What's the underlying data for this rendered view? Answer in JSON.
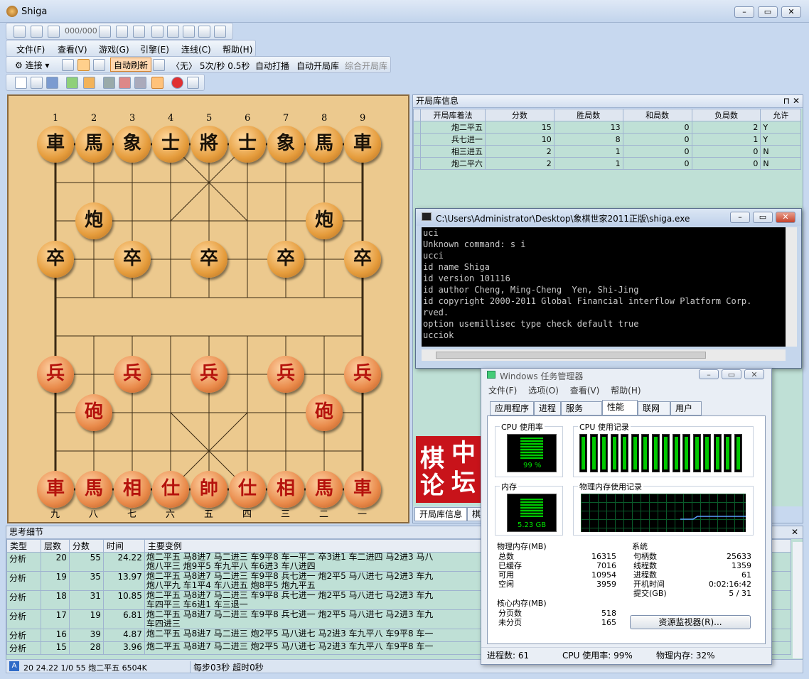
{
  "app": {
    "title": "Shiga",
    "move_counter": "000/000"
  },
  "menu": [
    "文件(F)",
    "查看(V)",
    "游戏(G)",
    "引擎(E)",
    "连线(C)",
    "帮助(H)"
  ],
  "toolbar2": {
    "connect": "连接",
    "auto_refresh": "自动刷新",
    "info": "〈无〉 5次/秒 0.5秒",
    "auto_play": "自动打播",
    "auto_book": "自动开局库",
    "combined_book": "综合开局库"
  },
  "board": {
    "top_coords": [
      "1",
      "2",
      "3",
      "4",
      "5",
      "6",
      "7",
      "8",
      "9"
    ],
    "bottom_coords": [
      "九",
      "八",
      "七",
      "六",
      "五",
      "四",
      "三",
      "二",
      "一"
    ],
    "black_back": [
      "車",
      "馬",
      "象",
      "士",
      "將",
      "士",
      "象",
      "馬",
      "車"
    ],
    "black_cannon": "炮",
    "black_pawn": "卒",
    "red_back": [
      "車",
      "馬",
      "相",
      "仕",
      "帥",
      "仕",
      "相",
      "馬",
      "車"
    ],
    "red_cannon": "砲",
    "red_pawn": "兵"
  },
  "book": {
    "title": "开局库信息",
    "headers": [
      "开局库着法",
      "分数",
      "胜局数",
      "和局数",
      "负局数",
      "允许"
    ],
    "rows": [
      [
        "炮二平五",
        "15",
        "13",
        "0",
        "2",
        "Y"
      ],
      [
        "兵七进一",
        "10",
        "8",
        "0",
        "1",
        "Y"
      ],
      [
        "相三进五",
        "2",
        "1",
        "0",
        "0",
        "N"
      ],
      [
        "炮二平六",
        "2",
        "1",
        "0",
        "0",
        "N"
      ]
    ],
    "tab1": "开局库信息",
    "tab2": "棋谱"
  },
  "console": {
    "title": "C:\\Users\\Administrator\\Desktop\\象棋世家2011正版\\shiga.exe",
    "lines": [
      "uci",
      "Unknown command: s i",
      "ucci",
      "id name Shiga",
      "id version 101116",
      "id author Cheng, Ming-Cheng  Yen, Shi-Jing",
      "id copyright 2000-2011 Global Financial interflow Platform Corp.",
      "rved.",
      "option usemillisec type check default true",
      "ucciok"
    ]
  },
  "logo": [
    "棋",
    "中",
    "论",
    "坛"
  ],
  "taskmgr": {
    "title": "Windows 任务管理器",
    "menu": [
      "文件(F)",
      "选项(O)",
      "查看(V)",
      "帮助(H)"
    ],
    "tabs": [
      "应用程序",
      "进程",
      "服务",
      "性能",
      "联网",
      "用户"
    ],
    "cpu_usage_label": "CPU 使用率",
    "cpu_value": "99 %",
    "cpu_history_label": "CPU 使用记录",
    "mem_label": "内存",
    "mem_value": "5.23 GB",
    "mem_history_label": "物理内存使用记录",
    "phys_title": "物理内存(MB)",
    "phys": [
      [
        "总数",
        "16315"
      ],
      [
        "已缓存",
        "7016"
      ],
      [
        "可用",
        "10954"
      ],
      [
        "空闲",
        "3959"
      ]
    ],
    "sys_title": "系统",
    "sys": [
      [
        "句柄数",
        "25633"
      ],
      [
        "线程数",
        "1359"
      ],
      [
        "进程数",
        "61"
      ],
      [
        "开机时间",
        "0:02:16:42"
      ],
      [
        "提交(GB)",
        "5 / 31"
      ]
    ],
    "kernel_title": "核心内存(MB)",
    "kernel": [
      [
        "分页数",
        "518"
      ],
      [
        "未分页",
        "165"
      ]
    ],
    "resmon": "资源监视器(R)...",
    "status": [
      "进程数: 61",
      "CPU 使用率: 99%",
      "物理内存: 32%"
    ]
  },
  "think": {
    "title": "思考细节",
    "headers": [
      "类型",
      "层数",
      "分数",
      "时间",
      "主要变例"
    ],
    "rows": [
      [
        "分析",
        "20",
        "55",
        "24.22",
        "炮二平五 马8进7 马二进三 车9平8 车一平二 卒3进1 车二进四 马2进3 马八",
        "炮八平三 炮9平5 车九平八 车6进3 车八进四"
      ],
      [
        "分析",
        "19",
        "35",
        "13.97",
        "炮二平五 马8进7 马二进三 车9平8 兵七进一 炮2平5 马八进七 马2进3 车九",
        "炮八平九 车1平4 车八进五 炮8平5 炮九平五"
      ],
      [
        "分析",
        "18",
        "31",
        "10.85",
        "炮二平五 马8进7 马二进三 车9平8 兵七进一 炮2平5 马八进七 马2进3 车九",
        "车四平三 车6进1 车三退一"
      ],
      [
        "分析",
        "17",
        "19",
        "6.81",
        "炮二平五 马8进7 马二进三 车9平8 兵七进一 炮2平5 马八进七 马2进3 车九",
        "车四进三"
      ],
      [
        "分析",
        "16",
        "39",
        "4.87",
        "炮二平五 马8进7 马二进三 炮2平5 马八进七 马2进3 车九平八 车9平8 车一",
        ""
      ],
      [
        "分析",
        "15",
        "28",
        "3.96",
        "炮二平五 马8进7 马二进三 炮2平5 马八进七 马2进3 车九平八 车9平8 车一",
        ""
      ]
    ]
  },
  "status": {
    "left": "20 24.22 1/0 55 炮二平五 6504K",
    "right": "每步03秒 超时0秒"
  }
}
